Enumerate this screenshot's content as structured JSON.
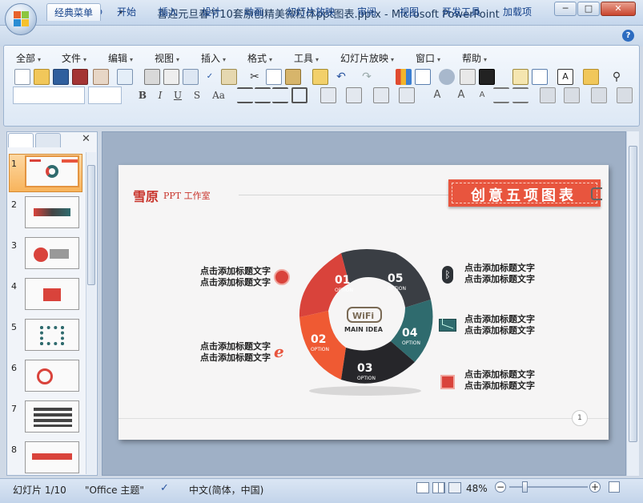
{
  "window": {
    "title": "喜迎元旦春节10套原创精美微粒体ppt图表.pptx - Microsoft PowerPoint",
    "controls": [
      "─",
      "□",
      "✕"
    ]
  },
  "ribbon": {
    "tabs": [
      "经典菜单",
      "开始",
      "插入",
      "设计",
      "动画",
      "幻灯片放映",
      "审阅",
      "视图",
      "开发工具",
      "加载项"
    ],
    "active_tab": "经典菜单",
    "menus": [
      "全部",
      "文件",
      "编辑",
      "视图",
      "插入",
      "格式",
      "工具",
      "幻灯片放映",
      "窗口",
      "帮助"
    ],
    "format_buttons": [
      "B",
      "I",
      "U",
      "S",
      "Aa"
    ],
    "help_glyph": "?"
  },
  "slides_panel": {
    "numbers": [
      "1",
      "2",
      "3",
      "4",
      "5",
      "6",
      "7",
      "8"
    ],
    "close_glyph": "✕"
  },
  "slide": {
    "logo_text": "雪原",
    "studio_text": "PPT 工作室",
    "banner_title": "创意五项图表",
    "center_brand": "WiFi",
    "center_label": "MAIN IDEA",
    "page_number": "1",
    "segments": [
      {
        "num": "01",
        "sub": "OPTION",
        "color": "#d9433b"
      },
      {
        "num": "02",
        "sub": "OPTION",
        "color": "#ef5a33"
      },
      {
        "num": "03",
        "sub": "OPTION",
        "color": "#26262a"
      },
      {
        "num": "04",
        "sub": "OPTION",
        "color": "#2f6b6e"
      },
      {
        "num": "05",
        "sub": "OPTION",
        "color": "#3a3e44"
      }
    ],
    "left_items": [
      {
        "line1": "点击添加标题文字",
        "line2": "点击添加标题文字",
        "icon": "globe-icon"
      },
      {
        "line1": "点击添加标题文字",
        "line2": "点击添加标题文字",
        "icon": "ie-icon"
      }
    ],
    "right_items": [
      {
        "line1": "点击添加标题文字",
        "line2": "点击添加标题文字",
        "icon": "bluetooth-icon"
      },
      {
        "line1": "点击添加标题文字",
        "line2": "点击添加标题文字",
        "icon": "mail-icon"
      },
      {
        "line1": "点击添加标题文字",
        "line2": "点击添加标题文字",
        "icon": "hand-icon"
      }
    ],
    "accent_color": "#e8553e"
  },
  "status": {
    "slide_info": "幻灯片 1/10",
    "theme": "\"Office 主题\"",
    "language": "中文(简体，中国)",
    "zoom": "48%"
  }
}
